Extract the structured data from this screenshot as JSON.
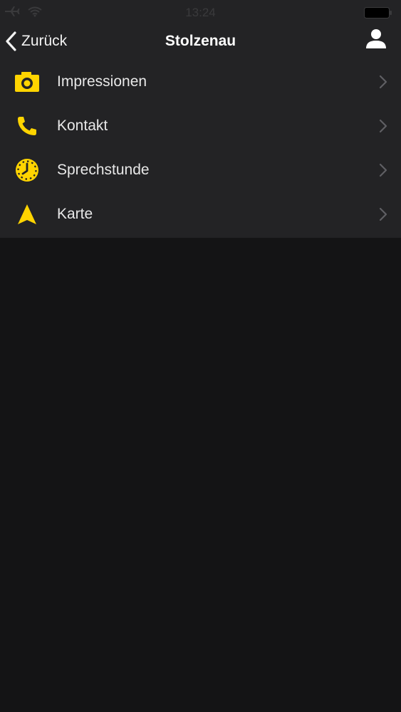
{
  "status_bar": {
    "time": "13:24",
    "icons": [
      "airplane-icon",
      "wifi-icon",
      "battery-icon"
    ]
  },
  "nav": {
    "back_label": "Zurück",
    "title": "Stolzenau",
    "right_icon": "person-icon"
  },
  "menu": {
    "items": [
      {
        "label": "Impressionen",
        "icon": "camera-icon"
      },
      {
        "label": "Kontakt",
        "icon": "phone-icon"
      },
      {
        "label": "Sprechstunde",
        "icon": "clock-icon"
      },
      {
        "label": "Karte",
        "icon": "navigation-arrow-icon"
      }
    ]
  },
  "colors": {
    "accent": "#ffd400",
    "header_bg": "#232325",
    "content_bg": "#141415",
    "chevron": "#5f5f63"
  }
}
